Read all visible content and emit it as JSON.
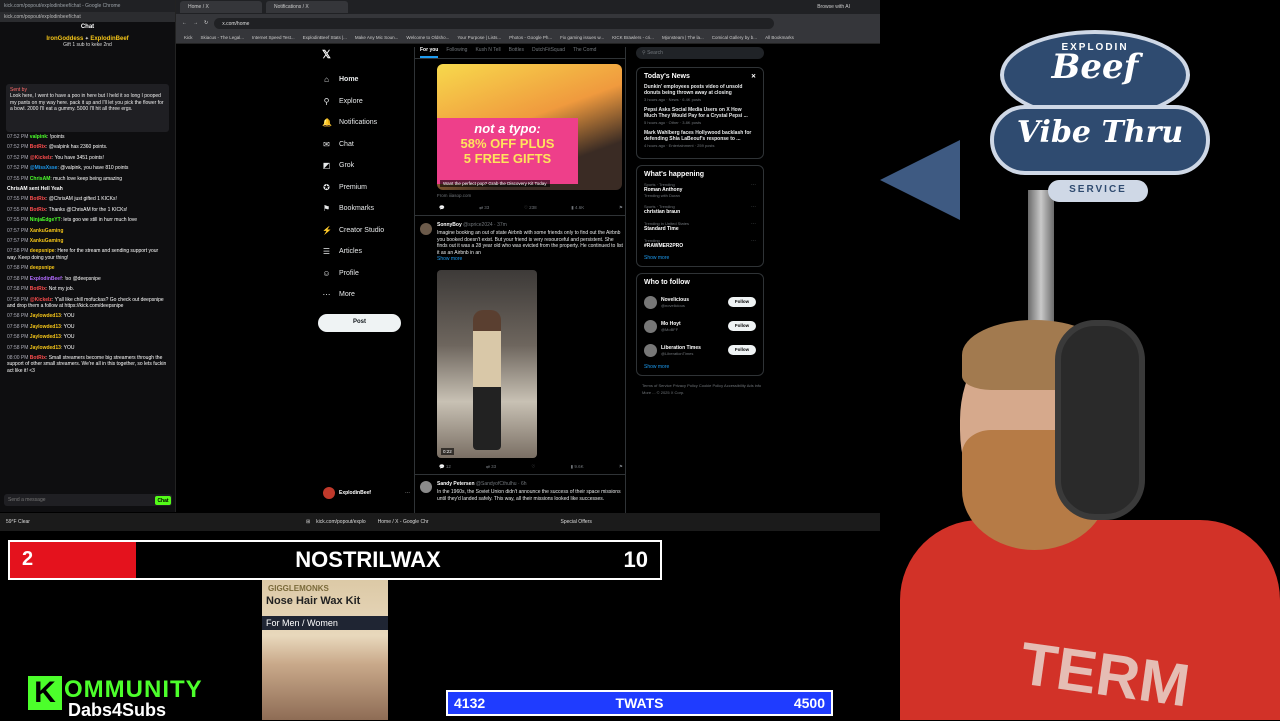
{
  "chat": {
    "window_title": "kick.com/popout/explodinbeef/chat - Google Chrome",
    "url": "kick.com/popout/explodinbeef/chat",
    "header": "Chat",
    "top_line1": "IronGoddess",
    "top_line2": "ExplodinBeef",
    "top_line3": "Gift 1 sub to keke 2nd",
    "pinned_tag": "Sent by",
    "pinned_text": "Look here, I went to have a poo in here but I held it so long I pooped my pants on my way here. pack it up and I'll let you pick the flower for a bowl. 2000 I'll eat a gummy. 5000 I'll hit all three ergs.",
    "messages": [
      {
        "time": "07:52 PM",
        "user": "valpink",
        "color": "#4cff2b",
        "text": "!points"
      },
      {
        "time": "07:52 PM",
        "user": "BotRix",
        "color": "#ff4d4d",
        "text": "@valpink has 2360 points."
      },
      {
        "time": "07:52 PM",
        "user": "@Kickelz",
        "color": "#ff4d4d",
        "text": "You have 3451 points!"
      },
      {
        "time": "07:52 PM",
        "user": "@MissXsse",
        "color": "#1d9bf0",
        "text": "@valpink, you have 810 points"
      },
      {
        "time": "07:55 PM",
        "user": "ChrisAM",
        "color": "#4cff2b",
        "text": "much love keep being amazing"
      },
      {
        "time": "",
        "user": "ChrisAM sent Hell Yeah",
        "color": "#fff",
        "text": ""
      },
      {
        "time": "07:55 PM",
        "user": "BotRix",
        "color": "#ff4d4d",
        "text": "@ChrisAM just gifted 1 KICKs!"
      },
      {
        "time": "07:55 PM",
        "user": "BotRix",
        "color": "#ff4d4d",
        "text": "Thanks @ChrisAM for the 1 KICKs!"
      },
      {
        "time": "07:55 PM",
        "user": "NinjaEdgeYT",
        "color": "#4cff2b",
        "text": "lets goo we still in hurr much love"
      },
      {
        "time": "07:57 PM",
        "user": "XankuGaming",
        "color": "#f5c518",
        "text": ""
      },
      {
        "time": "07:57 PM",
        "user": "XankuGaming",
        "color": "#f5c518",
        "text": ""
      },
      {
        "time": "07:58 PM",
        "user": "deepsnipe",
        "color": "#f5c518",
        "text": "Here for the stream and sending support your way. Keep doing your thing!"
      },
      {
        "time": "07:58 PM",
        "user": "deepsnipe",
        "color": "#f5c518",
        "text": ""
      },
      {
        "time": "07:58 PM",
        "user": "ExplodinBeef",
        "color": "#b36bff",
        "text": "!so @deepsnipe"
      },
      {
        "time": "07:58 PM",
        "user": "BotRix",
        "color": "#ff4d4d",
        "text": "Not my job."
      },
      {
        "time": "07:58 PM",
        "user": "@Kickelz",
        "color": "#ff4d4d",
        "text": "Y'all like chill mofuckas? Go check out deepsnipe and drop them a follow at https://kick.com/deepsnipe"
      },
      {
        "time": "07:58 PM",
        "user": "Jaylowded13",
        "color": "#f5c518",
        "text": "YOU"
      },
      {
        "time": "07:58 PM",
        "user": "Jaylowded13",
        "color": "#f5c518",
        "text": "YOU"
      },
      {
        "time": "07:58 PM",
        "user": "Jaylowded13",
        "color": "#f5c518",
        "text": "YOU"
      },
      {
        "time": "07:58 PM",
        "user": "Jaylowded13",
        "color": "#f5c518",
        "text": "YOU"
      },
      {
        "time": "08:00 PM",
        "user": "BotRix",
        "color": "#ff4d4d",
        "text": "Small streamers become big streamers through the support of other small streamers. We're all in this together, so lets fuckin act like it! <3"
      }
    ],
    "input_placeholder": "Send a message",
    "send_label": "Chat"
  },
  "browser": {
    "tabs": [
      "Home / X",
      "Notifications / X"
    ],
    "url": "x.com/home",
    "bookmarks": [
      "Kick",
      "Skiacus - The Legal...",
      "Internet Speed Test...",
      "ExplodinBeef Stats |...",
      "Make Any Mic Soun...",
      "Welcome to Oldsho...",
      "Your Purpose | Lists...",
      "Photos - Google Ph...",
      "Fix gaming issues w...",
      "KICK Brawlers - cri...",
      "Mjonsteam | The la...",
      "Comical Gallery by b...",
      "All Bookmarks"
    ],
    "browse_ai": "Browse with AI"
  },
  "x": {
    "nav": [
      {
        "icon": "⌂",
        "label": "Home"
      },
      {
        "icon": "⚲",
        "label": "Explore"
      },
      {
        "icon": "🔔",
        "label": "Notifications"
      },
      {
        "icon": "✉",
        "label": "Chat"
      },
      {
        "icon": "◩",
        "label": "Grok"
      },
      {
        "icon": "✪",
        "label": "Premium"
      },
      {
        "icon": "⚑",
        "label": "Bookmarks"
      },
      {
        "icon": "⚡",
        "label": "Creator Studio"
      },
      {
        "icon": "☰",
        "label": "Articles"
      },
      {
        "icon": "☺",
        "label": "Profile"
      },
      {
        "icon": "⋯",
        "label": "More"
      }
    ],
    "post_label": "Post",
    "profile_name": "ExplodinBeef",
    "profile_handle": "@ExplodinBeef",
    "feed_tabs": [
      "For you",
      "Following",
      "Kush N Tell",
      "Bottles",
      "DutchFitSquad",
      "The Comd"
    ],
    "ad": {
      "line1": "not a typo:",
      "line2": "58% OFF PLUS",
      "line3": "5 FREE GIFTS",
      "caption": "Want the perfect pop? Grab the Discovery Kit Today",
      "source": "From iiiasop.com",
      "actions": [
        "",
        "33",
        "",
        "238",
        "4.6K",
        ""
      ]
    },
    "tweet1": {
      "name": "SonnyBoy",
      "handle": "@sprice2024 · 37m",
      "text": "Imagine booking an out of state Airbnb with some friends only to find out the Airbnb you booked doesn't exist. But your friend is very resourceful and persistent. She finds out it was a 28 year old who was evicted from the property. He continued to list it as an Airbnb in an",
      "show_more": "Show more",
      "duration": "0:22",
      "actions": [
        "12",
        "33",
        "",
        "9.6K",
        "",
        ""
      ]
    },
    "tweet2": {
      "name": "Sandy Petersen",
      "handle": "@SandyofCthulhu · 6h",
      "text": "In the 1960s, the Soviet Union didn't announce the success of their space missions until they'd landed safely. This way, all their missions looked like successes."
    },
    "search_placeholder": "Search",
    "todays_news_title": "Today's News",
    "news": [
      {
        "title": "Dunkin' employees posts video of unsold donuts being thrown away at closing",
        "meta": "3 hours ago · News · 6.4K posts"
      },
      {
        "title": "Pepsi Asks Social Media Users on X How Much They Would Pay for a Crystal Pepsi ...",
        "meta": "5 hours ago · Other · 3.8K posts"
      },
      {
        "title": "Mark Wahlberg faces Hollywood backlash for defending Shia LaBeouf's response to ...",
        "meta": "4 hours ago · Entertainment · 259 posts"
      }
    ],
    "happening_title": "What's happening",
    "trends": [
      {
        "cat": "Sports · Trending",
        "name": "Roman Anthony",
        "extra": "Trending with Duran"
      },
      {
        "cat": "Sports · Trending",
        "name": "christian braun",
        "extra": ""
      },
      {
        "cat": "Trending in United States",
        "name": "Standard Time",
        "extra": ""
      },
      {
        "cat": "Trending",
        "name": "#RAWMER2PRO",
        "extra": ""
      }
    ],
    "show_more": "Show more",
    "wtf_title": "Who to follow",
    "follow": [
      {
        "name": "Novelicious",
        "handle": "@novelicious"
      },
      {
        "name": "Mo Hoyt",
        "handle": "@MoBFF"
      },
      {
        "name": "Liberation Times",
        "handle": "@LiberationTimes"
      }
    ],
    "follow_label": "Follow",
    "footer": "Terms of Service  Privacy Policy  Cookie Policy  Accessibility  Ads info  More ...  © 2025 X Corp."
  },
  "taskbar": {
    "weather_temp": "59°F",
    "weather_desc": "Clear",
    "items": [
      "kick.com/popout/explo",
      "Home / X - Google Chr",
      "Special Offers"
    ]
  },
  "overlay": {
    "count": "2",
    "name": "NOSTRILWAX",
    "goal": "10",
    "product_brand": "GIGGLEMONKS",
    "product_name": "Nose Hair Wax Kit",
    "product_sub": "For Men / Women",
    "kommunity": "OMMUNITY",
    "kommunity_k": "K",
    "dabs": "Dabs4Subs",
    "twats_left": "4132",
    "twats_mid": "TWATS",
    "twats_right": "4500"
  },
  "camera": {
    "sign_top": "EXPLODIN",
    "sign_main": "Beef",
    "sign_mid": "Vibe Thru",
    "sign_bottom": "SERVICE",
    "shirt_text": "TERM"
  }
}
